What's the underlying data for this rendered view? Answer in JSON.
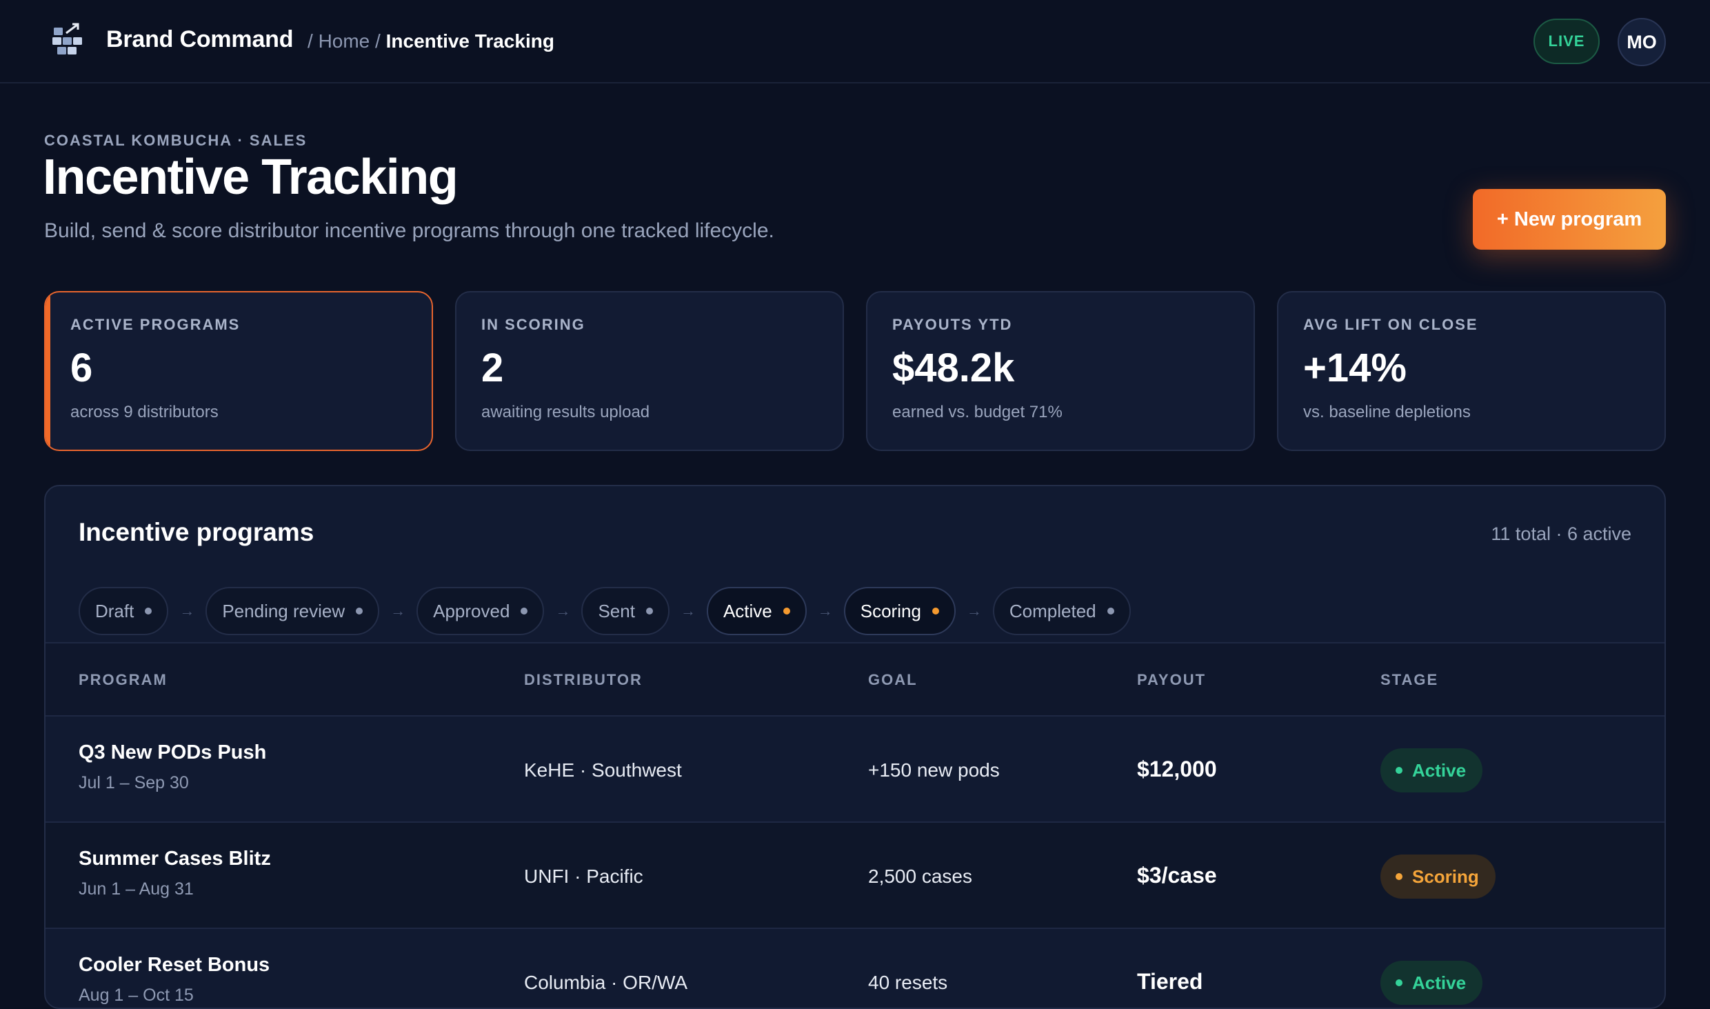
{
  "header": {
    "brand": "Brand Command",
    "breadcrumb": {
      "sep1": "/",
      "home": "Home",
      "sep2": "/",
      "current": "Incentive Tracking"
    },
    "live_label": "LIVE",
    "avatar_initials": "MO"
  },
  "page": {
    "eyebrow": "COASTAL KOMBUCHA · SALES",
    "title": "Incentive Tracking",
    "subtitle": "Build, send & score distributor incentive programs through one tracked lifecycle.",
    "new_button": "+ New program"
  },
  "kpis": [
    {
      "label": "ACTIVE PROGRAMS",
      "value": "6",
      "sub": "across 9 distributors"
    },
    {
      "label": "IN SCORING",
      "value": "2",
      "sub": "awaiting results upload"
    },
    {
      "label": "PAYOUTS YTD",
      "value": "$48.2k",
      "sub": "earned vs. budget 71%"
    },
    {
      "label": "AVG LIFT ON CLOSE",
      "value": "+14%",
      "sub": "vs. baseline depletions"
    }
  ],
  "programs": {
    "title": "Incentive programs",
    "meta": "11 total · 6 active",
    "arrow_glyph": "→",
    "stages": [
      {
        "label": "Draft"
      },
      {
        "label": "Pending review"
      },
      {
        "label": "Approved"
      },
      {
        "label": "Sent"
      },
      {
        "label": "Active"
      },
      {
        "label": "Scoring"
      },
      {
        "label": "Completed"
      }
    ],
    "columns": {
      "program": "PROGRAM",
      "distributor": "DISTRIBUTOR",
      "goal": "GOAL",
      "payout": "PAYOUT",
      "stage": "STAGE"
    },
    "rows": [
      {
        "name": "Q3 New PODs Push",
        "dates": "Jul 1 – Sep 30",
        "distributor": "KeHE · Southwest",
        "goal": "+150 new pods",
        "payout": "$12,000",
        "stage": "Active"
      },
      {
        "name": "Summer Cases Blitz",
        "dates": "Jun 1 – Aug 31",
        "distributor": "UNFI · Pacific",
        "goal": "2,500 cases",
        "payout": "$3/case",
        "stage": "Scoring"
      },
      {
        "name": "Cooler Reset Bonus",
        "dates": "Aug 1 – Oct 15",
        "distributor": "Columbia · OR/WA",
        "goal": "40 resets",
        "payout": "Tiered",
        "stage": "Active"
      }
    ]
  },
  "colors": {
    "background": "#0b1122",
    "accent": "#f26a28",
    "accent_end": "#f4a03e",
    "active_green": "#34d399",
    "scoring_orange": "#f5a53a"
  }
}
